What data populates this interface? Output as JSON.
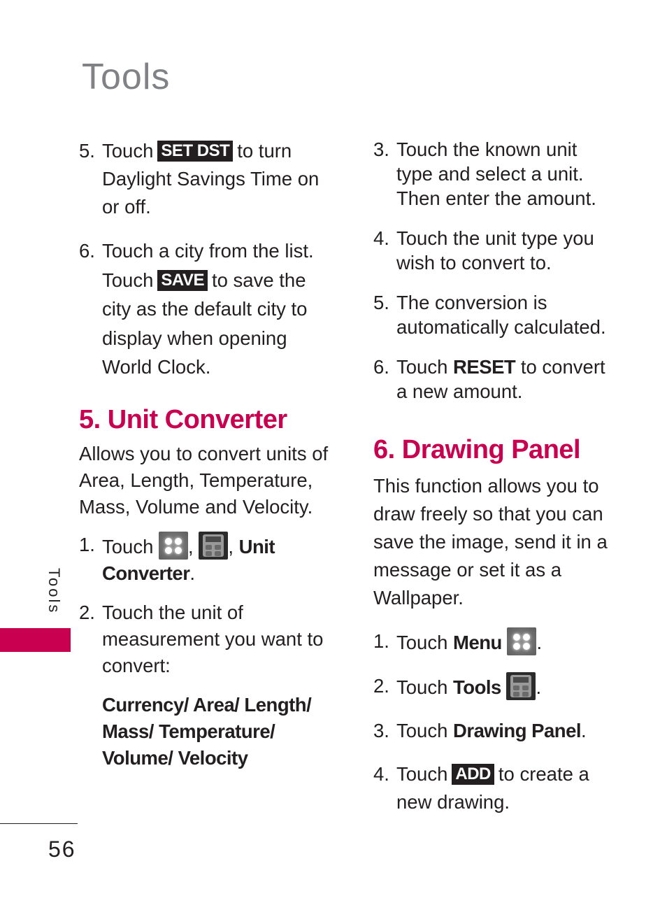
{
  "page": {
    "title": "Tools",
    "side_tab": "Tools",
    "page_number": "56",
    "accent_color": "#c8004f"
  },
  "left": {
    "step5": {
      "num": "5.",
      "pre": "Touch",
      "key": "SET DST",
      "post": "to turn Daylight Savings Time on or off."
    },
    "step6": {
      "num": "6.",
      "line1": "Touch a city from the list.",
      "pre": "Touch",
      "key": "SAVE",
      "post": "to save the city as the default city to display when opening World Clock."
    },
    "section": {
      "heading": "5. Unit Converter",
      "intro": "Allows you to convert units of Area, Length, Temperature, Mass, Volume and Velocity.",
      "steps": [
        {
          "num": "1.",
          "pre": "Touch",
          "icons": [
            "menu-icon",
            "tools-icon"
          ],
          "bold": "Unit Converter",
          "post": "."
        },
        {
          "num": "2.",
          "text": "Touch the unit of measurement you want to convert:"
        }
      ],
      "units": [
        "Currency/ Area/ Length/",
        "Mass/ Temperature/",
        "Volume/ Velocity"
      ]
    }
  },
  "right": {
    "steps": [
      {
        "num": "3.",
        "text": "Touch the known unit type and select a unit. Then enter the amount."
      },
      {
        "num": "4.",
        "text": "Touch the unit type you wish to convert to."
      },
      {
        "num": "5.",
        "text": "The conversion is automatically calculated."
      },
      {
        "num": "6.",
        "pre": "Touch",
        "bold": "RESET",
        "post": "to convert a new amount."
      }
    ],
    "section": {
      "heading": "6. Drawing Panel",
      "intro": "This function allows you to draw freely so that you can save the image, send it in a message or set it as a Wallpaper.",
      "steps": [
        {
          "num": "1.",
          "pre": "Touch",
          "bold": "Menu",
          "icon": "menu-icon",
          "post": "."
        },
        {
          "num": "2.",
          "pre": "Touch",
          "bold": "Tools",
          "icon": "tools-icon",
          "post": "."
        },
        {
          "num": "3.",
          "pre": "Touch",
          "bold": "Drawing Panel",
          "post": "."
        },
        {
          "num": "4.",
          "pre": "Touch",
          "key": "ADD",
          "post": "to create a new drawing."
        }
      ]
    }
  }
}
